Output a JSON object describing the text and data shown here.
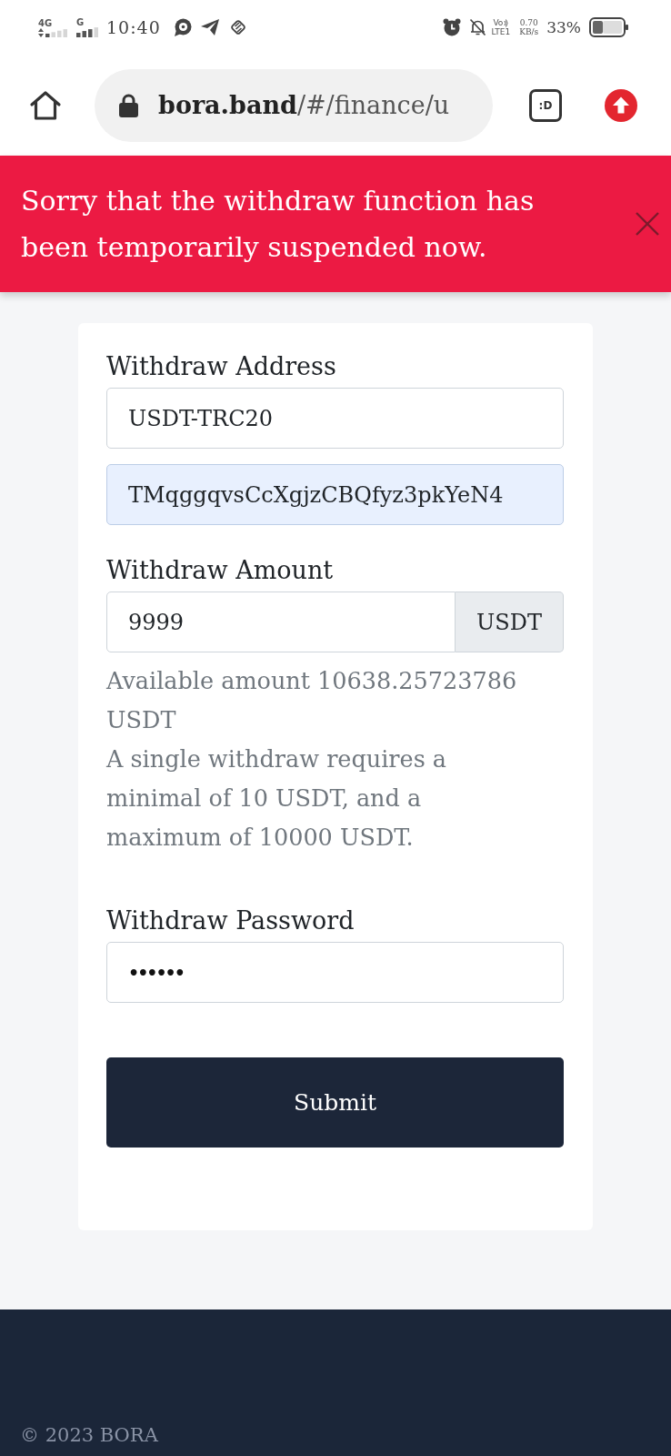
{
  "status_bar": {
    "network_1": "4G",
    "network_2": "G",
    "time": "10:40",
    "volte_top": "Vo",
    "volte_bottom": "LTE1",
    "speed_value": "0.70",
    "speed_unit": "KB/s",
    "battery": "33%"
  },
  "browser": {
    "url": "**bora.band**/#/finance/u",
    "tab_count": ":D"
  },
  "alert": {
    "message": "Sorry that the withdraw function has been temporarily suspended now."
  },
  "form": {
    "groups": [
      {
        "label": "Withdraw Address",
        "inputs": [
          {
            "kind": "text",
            "value": "USDT-TRC20",
            "autofilled": false
          },
          {
            "kind": "text",
            "value": "TMqggqvsCcXgjzCBQfyz3pkYeN4",
            "autofilled": true
          }
        ]
      },
      {
        "label": "Withdraw Amount",
        "inputs": [
          {
            "kind": "addon",
            "value": "9999",
            "addon": "USDT",
            "autofilled": false
          }
        ],
        "help": [
          "Available amount 10638.25723786 USDT",
          "A single withdraw requires a minimal of 10 USDT, and a maximum of 10000 USDT."
        ]
      },
      {
        "label": "Withdraw Password",
        "inputs": [
          {
            "kind": "password",
            "value": "••••••",
            "autofilled": false
          }
        ]
      }
    ],
    "submit": "Submit"
  },
  "footer": {
    "copyright": "© 2023 BORA"
  }
}
